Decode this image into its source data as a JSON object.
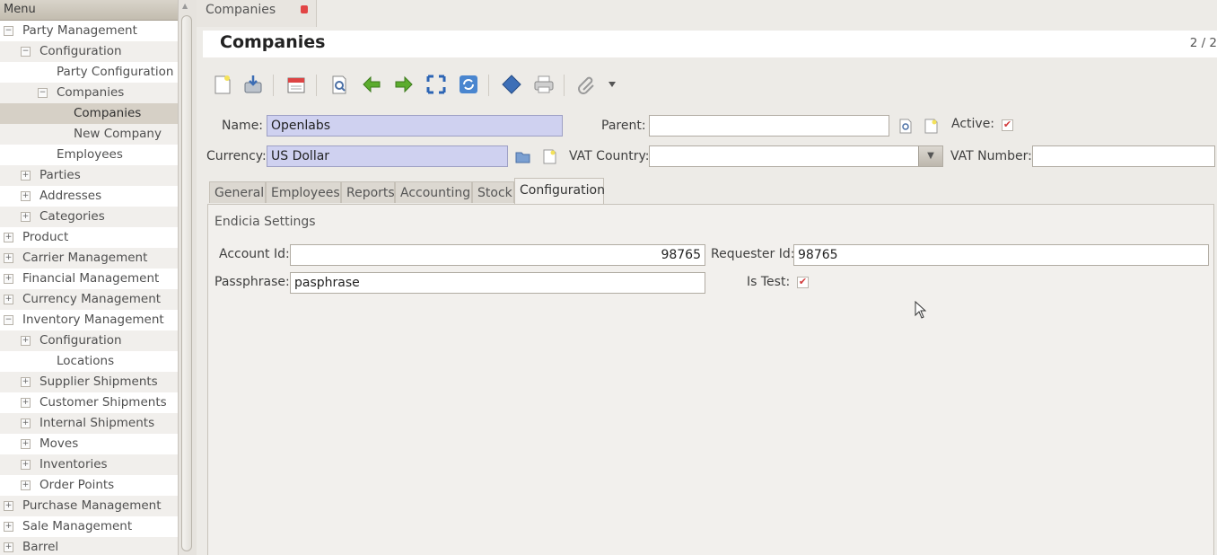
{
  "sidebar": {
    "header": "Menu",
    "items": [
      {
        "label": "Party Management",
        "level": 0,
        "expander": "−"
      },
      {
        "label": "Configuration",
        "level": 1,
        "expander": "−"
      },
      {
        "label": "Party Configuration",
        "level": 3,
        "expander": ""
      },
      {
        "label": "Companies",
        "level": 2,
        "expander": "−"
      },
      {
        "label": "Companies",
        "level": 4,
        "expander": "",
        "selected": true
      },
      {
        "label": "New Company",
        "level": 4,
        "expander": ""
      },
      {
        "label": "Employees",
        "level": 3,
        "expander": ""
      },
      {
        "label": "Parties",
        "level": 1,
        "expander": "+"
      },
      {
        "label": "Addresses",
        "level": 1,
        "expander": "+"
      },
      {
        "label": "Categories",
        "level": 1,
        "expander": "+"
      },
      {
        "label": "Product",
        "level": 0,
        "expander": "+"
      },
      {
        "label": "Carrier Management",
        "level": 0,
        "expander": "+"
      },
      {
        "label": "Financial Management",
        "level": 0,
        "expander": "+"
      },
      {
        "label": "Currency Management",
        "level": 0,
        "expander": "+"
      },
      {
        "label": "Inventory Management",
        "level": 0,
        "expander": "−"
      },
      {
        "label": "Configuration",
        "level": 1,
        "expander": "+"
      },
      {
        "label": "Locations",
        "level": 2,
        "expander": ""
      },
      {
        "label": "Supplier Shipments",
        "level": 1,
        "expander": "+"
      },
      {
        "label": "Customer Shipments",
        "level": 1,
        "expander": "+"
      },
      {
        "label": "Internal Shipments",
        "level": 1,
        "expander": "+"
      },
      {
        "label": "Moves",
        "level": 1,
        "expander": "+"
      },
      {
        "label": "Inventories",
        "level": 1,
        "expander": "+"
      },
      {
        "label": "Order Points",
        "level": 1,
        "expander": "+"
      },
      {
        "label": "Purchase Management",
        "level": 0,
        "expander": "+"
      },
      {
        "label": "Sale Management",
        "level": 0,
        "expander": "+"
      },
      {
        "label": "Barrel",
        "level": 0,
        "expander": "+"
      }
    ]
  },
  "top_tab": {
    "label": "Companies"
  },
  "page": {
    "title": "Companies",
    "record_count": "2 / 2"
  },
  "form": {
    "name_label": "Name:",
    "name_value": "Openlabs",
    "parent_label": "Parent:",
    "parent_value": "",
    "active_label": "Active:",
    "active_checked": "✔",
    "currency_label": "Currency:",
    "currency_value": "US Dollar",
    "vat_country_label": "VAT Country:",
    "vat_country_value": "",
    "vat_number_label": "VAT Number:",
    "vat_number_value": ""
  },
  "notebook": {
    "tabs": [
      "General",
      "Employees",
      "Reports",
      "Accounting",
      "Stock",
      "Configuration"
    ],
    "active_tab": "Configuration",
    "group_title": "Endicia Settings",
    "account_id_label": "Account Id:",
    "account_id_value": "98765",
    "requester_id_label": "Requester Id:",
    "requester_id_value": "98765",
    "passphrase_label": "Passphrase:",
    "passphrase_value": "pasphrase",
    "is_test_label": "Is Test:",
    "is_test_checked": "✔"
  },
  "colors": {
    "required_field": "#cfd1f0",
    "selected_row": "#d6d0c6",
    "checkbox_mark": "#d23a3a"
  }
}
